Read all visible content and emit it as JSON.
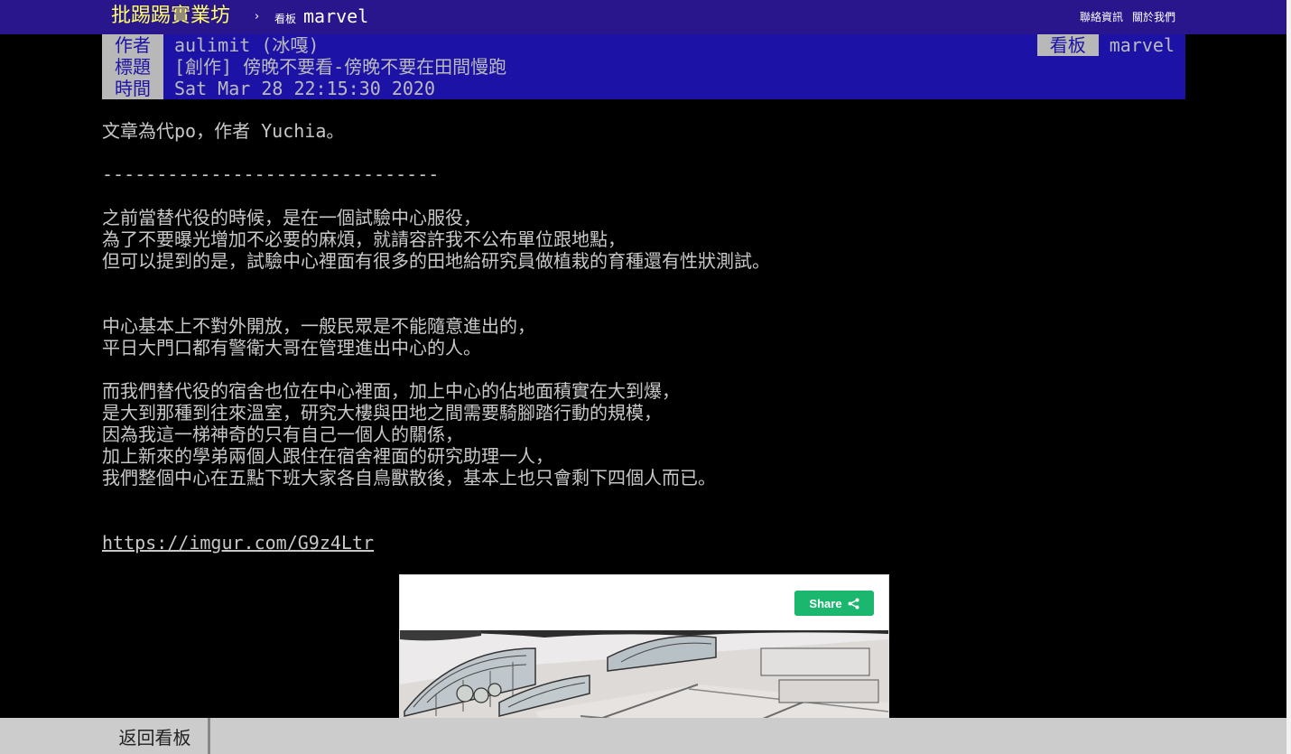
{
  "topbar": {
    "site_title": "批踢踢實業坊",
    "separator": "›",
    "board_prefix": "看板",
    "board_name": "marvel",
    "links": [
      "聯絡資訊",
      "關於我們"
    ]
  },
  "meta": {
    "author_label": "作者",
    "author_value": "aulimit (冰嘎)",
    "title_label": "標題",
    "title_value": "[創作] 傍晚不要看-傍晚不要在田間慢跑",
    "time_label": "時間",
    "time_value": "Sat Mar 28 22:15:30 2020",
    "board_label": "看板",
    "board_value": "marvel"
  },
  "article": {
    "intro": "文章為代po，作者 Yuchia。",
    "divider": "-------------------------------",
    "para1": [
      "之前當替代役的時候，是在一個試驗中心服役，",
      "為了不要曝光增加不必要的麻煩，就請容許我不公布單位跟地點，",
      "但可以提到的是，試驗中心裡面有很多的田地給研究員做植栽的育種還有性狀測試。"
    ],
    "para2": [
      "中心基本上不對外開放，一般民眾是不能隨意進出的，",
      "平日大門口都有警衛大哥在管理進出中心的人。"
    ],
    "para3": [
      "而我們替代役的宿舍也位在中心裡面，加上中心的佔地面積實在大到爆，",
      "是大到那種到往來溫室，研究大樓與田地之間需要騎腳踏行動的規模，",
      "因為我這一梯神奇的只有自己一個人的關係，",
      "加上新來的學弟兩個人跟住在宿舍裡面的研究助理一人，",
      "我們整個中心在五點下班大家各自鳥獸散後，基本上也只會剩下四個人而已。"
    ],
    "link": "https://imgur.com/G9z4Ltr"
  },
  "embed": {
    "share_label": "Share",
    "share_icon": "share-icon"
  },
  "bottombar": {
    "back_label": "返回看板"
  },
  "colors": {
    "topbar_bg": "#2a168c",
    "meta_bg": "#1d12a6",
    "meta_tag_bg": "#b8b8b8",
    "site_title": "#ffff66",
    "share_green": "#1bb76e"
  }
}
